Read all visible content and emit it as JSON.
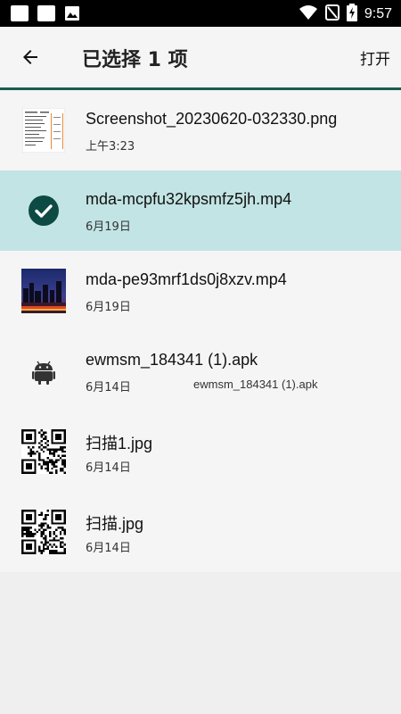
{
  "status_bar": {
    "time": "9:57",
    "icons": [
      "notification-square-icon",
      "notification-square-icon",
      "image-notification-icon",
      "wifi-icon",
      "no-sim-icon",
      "battery-charging-icon"
    ]
  },
  "app_bar": {
    "title": "已选择 1 项",
    "open_label": "打开",
    "back_icon": "arrow-left-icon"
  },
  "colors": {
    "selected_row": "#c2e4e4",
    "accent": "#1c5a50",
    "check_circle": "#0d4a44"
  },
  "files": [
    {
      "name": "Screenshot_20230620-032330.png",
      "date": "上午3:23",
      "summary": "",
      "thumb": "document-thumbnail",
      "selected": false
    },
    {
      "name": "mda-mcpfu32kpsmfz5jh.mp4",
      "date": "6月19日",
      "summary": "",
      "thumb": "check-circle-icon",
      "selected": true
    },
    {
      "name": "mda-pe93mrf1ds0j8xzv.mp4",
      "date": "6月19日",
      "summary": "",
      "thumb": "video-thumbnail",
      "selected": false
    },
    {
      "name": "ewmsm_184341 (1).apk",
      "date": "6月14日",
      "summary": "ewmsm_184341 (1).apk",
      "thumb": "android-icon",
      "selected": false
    },
    {
      "name": "扫描1.jpg",
      "date": "6月14日",
      "summary": "",
      "thumb": "qr-code-thumbnail",
      "selected": false
    },
    {
      "name": "扫描.jpg",
      "date": "6月14日",
      "summary": "",
      "thumb": "qr-code-thumbnail",
      "selected": false
    }
  ]
}
